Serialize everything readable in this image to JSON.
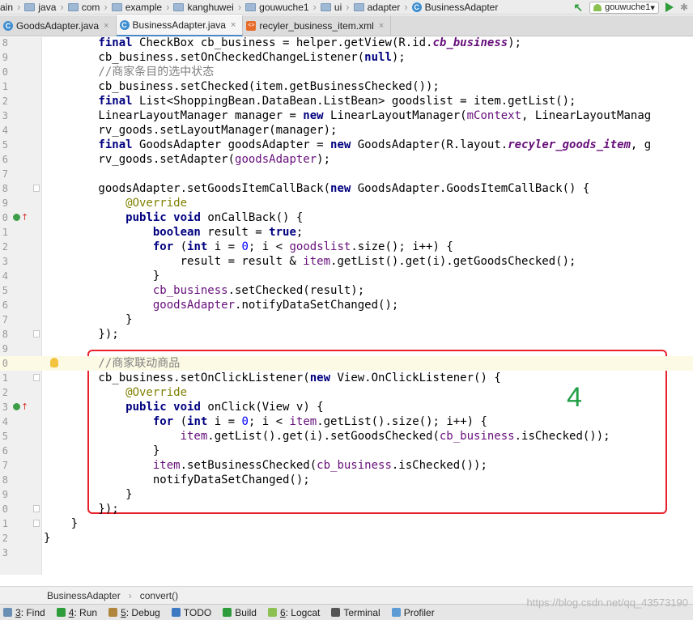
{
  "navbar": {
    "crumbs": [
      "ain",
      "java",
      "com",
      "example",
      "kanghuwei",
      "gouwuche1",
      "ui",
      "adapter",
      "BusinessAdapter"
    ],
    "run_config": "gouwuche1"
  },
  "tabs": [
    {
      "label": "GoodsAdapter.java",
      "active": false
    },
    {
      "label": "BusinessAdapter.java",
      "active": true
    },
    {
      "label": "recyler_business_item.xml",
      "active": false
    }
  ],
  "code_lines": [
    {
      "n": "8",
      "code": "        final CheckBox cb_business = helper.getView(R.id.cb_business);"
    },
    {
      "n": "9",
      "code": "        cb_business.setOnCheckedChangeListener(null);"
    },
    {
      "n": "0",
      "code": "        //商家条目的选中状态"
    },
    {
      "n": "1",
      "code": "        cb_business.setChecked(item.getBusinessChecked());"
    },
    {
      "n": "2",
      "code": "        final List<ShoppingBean.DataBean.ListBean> goodslist = item.getList();"
    },
    {
      "n": "3",
      "code": "        LinearLayoutManager manager = new LinearLayoutManager(mContext, LinearLayoutManag"
    },
    {
      "n": "4",
      "code": "        rv_goods.setLayoutManager(manager);"
    },
    {
      "n": "5",
      "code": "        final GoodsAdapter goodsAdapter = new GoodsAdapter(R.layout.recyler_goods_item, g"
    },
    {
      "n": "6",
      "code": "        rv_goods.setAdapter(goodsAdapter);"
    },
    {
      "n": "7",
      "code": ""
    },
    {
      "n": "8",
      "code": "        goodsAdapter.setGoodsItemCallBack(new GoodsAdapter.GoodsItemCallBack() {"
    },
    {
      "n": "9",
      "code": "            @Override"
    },
    {
      "n": "0",
      "code": "            public void onCallBack() {"
    },
    {
      "n": "1",
      "code": "                boolean result = true;"
    },
    {
      "n": "2",
      "code": "                for (int i = 0; i < goodslist.size(); i++) {"
    },
    {
      "n": "3",
      "code": "                    result = result & item.getList().get(i).getGoodsChecked();"
    },
    {
      "n": "4",
      "code": "                }"
    },
    {
      "n": "5",
      "code": "                cb_business.setChecked(result);"
    },
    {
      "n": "6",
      "code": "                goodsAdapter.notifyDataSetChanged();"
    },
    {
      "n": "7",
      "code": "            }"
    },
    {
      "n": "8",
      "code": "        });"
    },
    {
      "n": "9",
      "code": ""
    },
    {
      "n": "0",
      "code": "        //商家联动商品"
    },
    {
      "n": "1",
      "code": "        cb_business.setOnClickListener(new View.OnClickListener() {"
    },
    {
      "n": "2",
      "code": "            @Override"
    },
    {
      "n": "3",
      "code": "            public void onClick(View v) {"
    },
    {
      "n": "4",
      "code": "                for (int i = 0; i < item.getList().size(); i++) {"
    },
    {
      "n": "5",
      "code": "                    item.getList().get(i).setGoodsChecked(cb_business.isChecked());"
    },
    {
      "n": "6",
      "code": "                }"
    },
    {
      "n": "7",
      "code": "                item.setBusinessChecked(cb_business.isChecked());"
    },
    {
      "n": "8",
      "code": "                notifyDataSetChanged();"
    },
    {
      "n": "9",
      "code": "            }"
    },
    {
      "n": "0",
      "code": "        });"
    },
    {
      "n": "1",
      "code": "    }"
    },
    {
      "n": "2",
      "code": "}"
    },
    {
      "n": "3",
      "code": ""
    }
  ],
  "annotation_number": "4",
  "footer_breadcrumb": [
    "BusinessAdapter",
    "convert()"
  ],
  "tool_windows": [
    {
      "num": "3",
      "label": ": Find",
      "color": "#6a8fb5"
    },
    {
      "num": "4",
      "label": ": Run",
      "color": "#2e9c3a"
    },
    {
      "num": "5",
      "label": ": Debug",
      "color": "#b0863c"
    },
    {
      "num": "",
      "label": "TODO",
      "color": "#3d78c2"
    },
    {
      "num": "",
      "label": "Build",
      "color": "#2e9c3a"
    },
    {
      "num": "6",
      "label": ": Logcat",
      "color": "#8cc152"
    },
    {
      "num": "",
      "label": "Terminal",
      "color": "#555555"
    },
    {
      "num": "",
      "label": "Profiler",
      "color": "#5c9bd6"
    }
  ],
  "watermark": "https://blog.csdn.net/qq_43573190"
}
